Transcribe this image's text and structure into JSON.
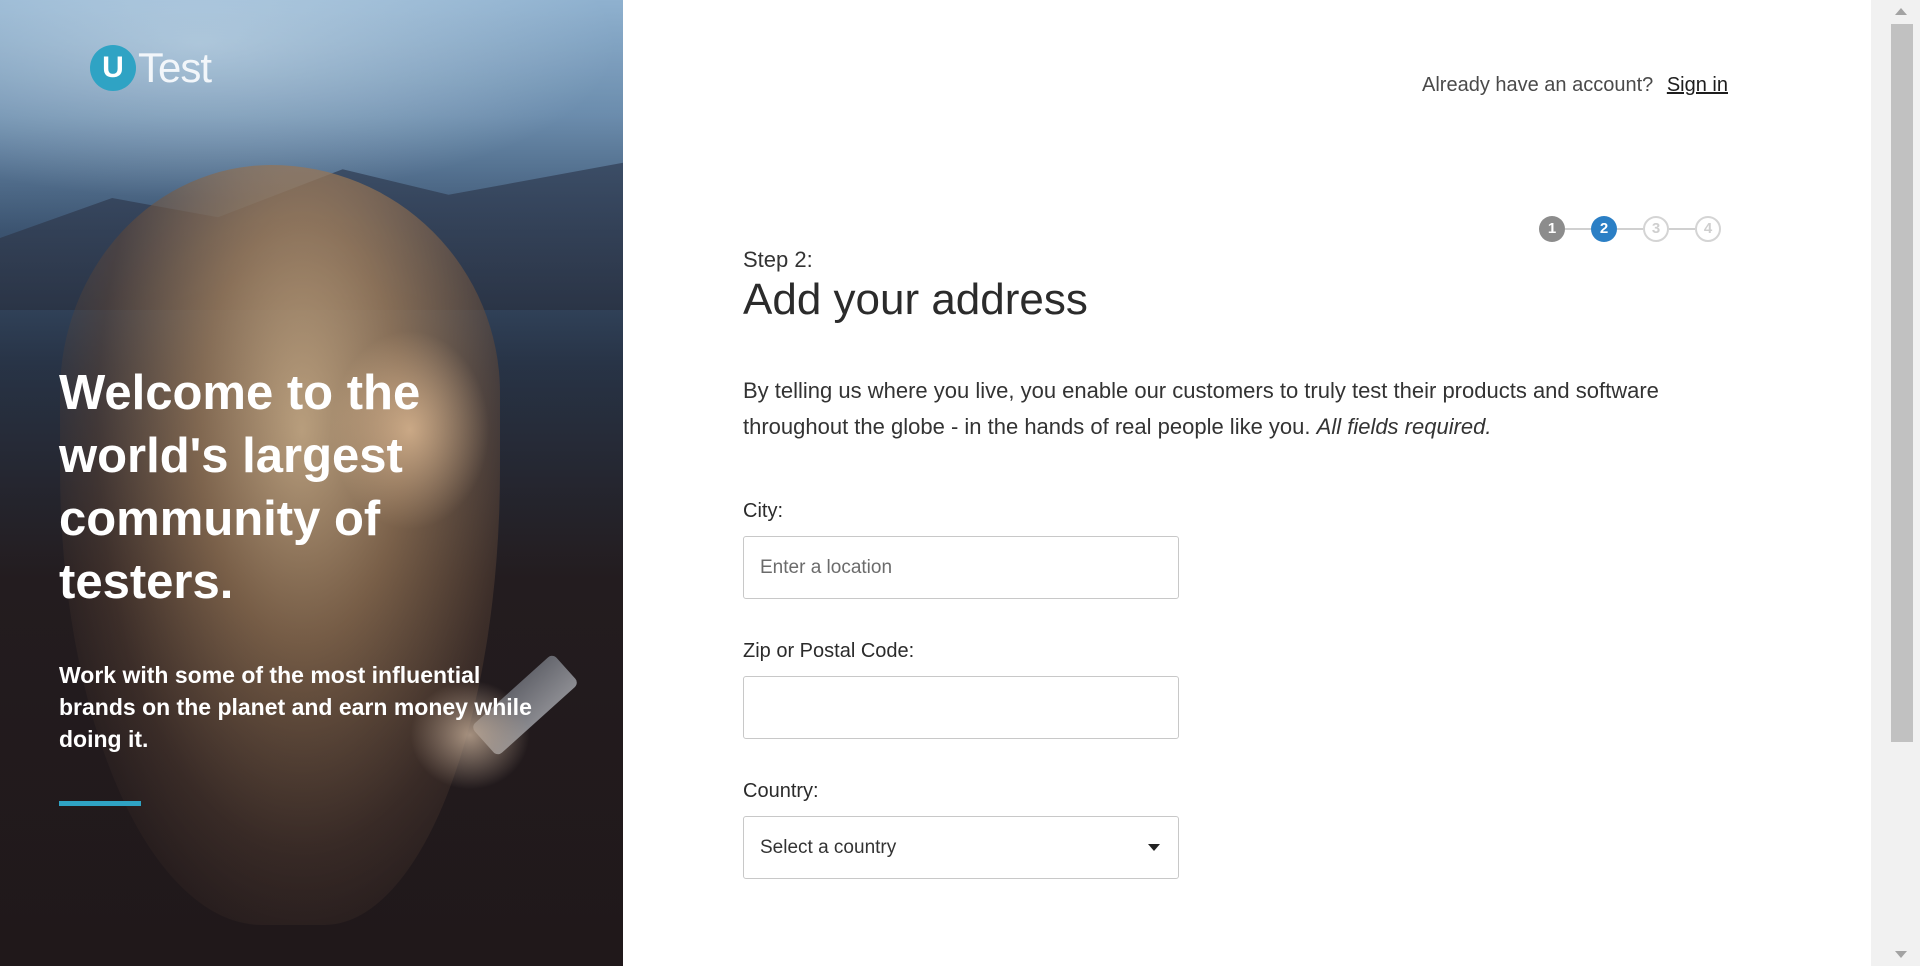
{
  "hero": {
    "logo_mark": "U",
    "logo_text": "Test",
    "title": "Welcome to the world's largest community of testers.",
    "subtitle": "Work with some of the most influential brands on the planet and earn money while doing it."
  },
  "header": {
    "question": "Already have an account?",
    "signin_label": "Sign in"
  },
  "steps": {
    "items": [
      "1",
      "2",
      "3",
      "4"
    ],
    "current": 2
  },
  "main": {
    "step_label": "Step 2:",
    "title": "Add your address",
    "intro": "By telling us where you live, you enable our customers to truly test their products and software throughout the globe - in the hands of real people like you.",
    "intro_emphasis": "All fields required."
  },
  "form": {
    "city_label": "City:",
    "city_placeholder": "Enter a location",
    "city_value": "",
    "zip_label": "Zip or Postal Code:",
    "zip_value": "",
    "country_label": "Country:",
    "country_selected": "Select a country"
  },
  "colors": {
    "accent": "#2fa3c4",
    "step_active": "#2b7fc5",
    "step_done": "#8c8c8c"
  }
}
